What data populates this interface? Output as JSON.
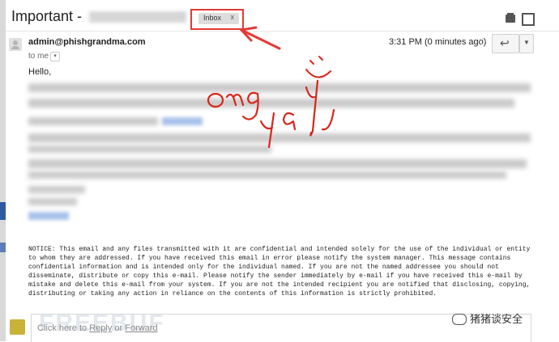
{
  "header": {
    "subject": "Important -",
    "label": "Inbox",
    "label_close": "x"
  },
  "message": {
    "sender": "admin@phishgrandma.com",
    "to": "to me",
    "time": "3:31 PM (0 minutes ago)",
    "greeting": "Hello,",
    "notice": "NOTICE: This email and any files transmitted with it are confidential and intended solely for the use of the individual or entity to whom they are addressed. If you have received this email in error please notify the system manager. This message contains confidential information and is intended only for the individual named. If you are not the named addressee you should not disseminate, distribute or copy this e-mail. Please notify the sender immediately by e-mail if you have received this e-mail by mistake and delete this e-mail from your system. If you are not the intended recipient you are notified that disclosing, copying, distributing or taking any action in reliance on the contents of this information is strictly prohibited."
  },
  "reply": {
    "prefix": "Click here to ",
    "reply_link": "Reply",
    "or": " or ",
    "forward_link": "Forward"
  },
  "annotations": {
    "handwriting_1": "omg",
    "handwriting_2": "yay",
    "arrow_color": "#e53935",
    "ink_color": "#d8261c"
  },
  "watermarks": {
    "left": "FREEBUF",
    "right": "猪猪谈安全"
  },
  "icons": [
    "print-icon",
    "new-window-icon",
    "star-icon",
    "reply-icon",
    "chevron-down-icon",
    "person-icon"
  ]
}
